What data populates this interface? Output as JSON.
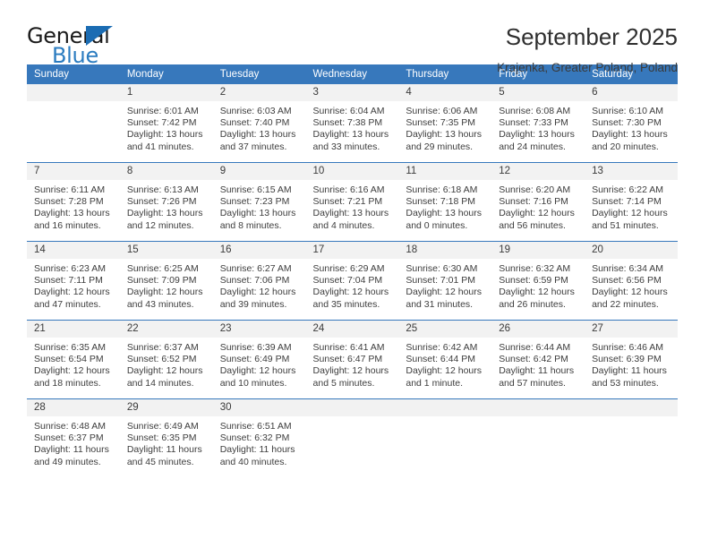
{
  "logo": {
    "word_top": "General",
    "word_bottom": "Blue",
    "triangle_color": "#1b6cb3",
    "blue_text_color": "#2b7cc0"
  },
  "header": {
    "title": "September 2025",
    "location": "Krajenka, Greater Poland, Poland"
  },
  "theme": {
    "header_blue": "#3778bc",
    "daynum_band": "#f2f2f2",
    "text": "#3d3d3d"
  },
  "weekday_headers": [
    "Sunday",
    "Monday",
    "Tuesday",
    "Wednesday",
    "Thursday",
    "Friday",
    "Saturday"
  ],
  "weeks": [
    [
      {
        "day": "",
        "sunrise": "",
        "sunset": "",
        "daylight1": "",
        "daylight2": ""
      },
      {
        "day": "1",
        "sunrise": "Sunrise: 6:01 AM",
        "sunset": "Sunset: 7:42 PM",
        "daylight1": "Daylight: 13 hours",
        "daylight2": "and 41 minutes."
      },
      {
        "day": "2",
        "sunrise": "Sunrise: 6:03 AM",
        "sunset": "Sunset: 7:40 PM",
        "daylight1": "Daylight: 13 hours",
        "daylight2": "and 37 minutes."
      },
      {
        "day": "3",
        "sunrise": "Sunrise: 6:04 AM",
        "sunset": "Sunset: 7:38 PM",
        "daylight1": "Daylight: 13 hours",
        "daylight2": "and 33 minutes."
      },
      {
        "day": "4",
        "sunrise": "Sunrise: 6:06 AM",
        "sunset": "Sunset: 7:35 PM",
        "daylight1": "Daylight: 13 hours",
        "daylight2": "and 29 minutes."
      },
      {
        "day": "5",
        "sunrise": "Sunrise: 6:08 AM",
        "sunset": "Sunset: 7:33 PM",
        "daylight1": "Daylight: 13 hours",
        "daylight2": "and 24 minutes."
      },
      {
        "day": "6",
        "sunrise": "Sunrise: 6:10 AM",
        "sunset": "Sunset: 7:30 PM",
        "daylight1": "Daylight: 13 hours",
        "daylight2": "and 20 minutes."
      }
    ],
    [
      {
        "day": "7",
        "sunrise": "Sunrise: 6:11 AM",
        "sunset": "Sunset: 7:28 PM",
        "daylight1": "Daylight: 13 hours",
        "daylight2": "and 16 minutes."
      },
      {
        "day": "8",
        "sunrise": "Sunrise: 6:13 AM",
        "sunset": "Sunset: 7:26 PM",
        "daylight1": "Daylight: 13 hours",
        "daylight2": "and 12 minutes."
      },
      {
        "day": "9",
        "sunrise": "Sunrise: 6:15 AM",
        "sunset": "Sunset: 7:23 PM",
        "daylight1": "Daylight: 13 hours",
        "daylight2": "and 8 minutes."
      },
      {
        "day": "10",
        "sunrise": "Sunrise: 6:16 AM",
        "sunset": "Sunset: 7:21 PM",
        "daylight1": "Daylight: 13 hours",
        "daylight2": "and 4 minutes."
      },
      {
        "day": "11",
        "sunrise": "Sunrise: 6:18 AM",
        "sunset": "Sunset: 7:18 PM",
        "daylight1": "Daylight: 13 hours",
        "daylight2": "and 0 minutes."
      },
      {
        "day": "12",
        "sunrise": "Sunrise: 6:20 AM",
        "sunset": "Sunset: 7:16 PM",
        "daylight1": "Daylight: 12 hours",
        "daylight2": "and 56 minutes."
      },
      {
        "day": "13",
        "sunrise": "Sunrise: 6:22 AM",
        "sunset": "Sunset: 7:14 PM",
        "daylight1": "Daylight: 12 hours",
        "daylight2": "and 51 minutes."
      }
    ],
    [
      {
        "day": "14",
        "sunrise": "Sunrise: 6:23 AM",
        "sunset": "Sunset: 7:11 PM",
        "daylight1": "Daylight: 12 hours",
        "daylight2": "and 47 minutes."
      },
      {
        "day": "15",
        "sunrise": "Sunrise: 6:25 AM",
        "sunset": "Sunset: 7:09 PM",
        "daylight1": "Daylight: 12 hours",
        "daylight2": "and 43 minutes."
      },
      {
        "day": "16",
        "sunrise": "Sunrise: 6:27 AM",
        "sunset": "Sunset: 7:06 PM",
        "daylight1": "Daylight: 12 hours",
        "daylight2": "and 39 minutes."
      },
      {
        "day": "17",
        "sunrise": "Sunrise: 6:29 AM",
        "sunset": "Sunset: 7:04 PM",
        "daylight1": "Daylight: 12 hours",
        "daylight2": "and 35 minutes."
      },
      {
        "day": "18",
        "sunrise": "Sunrise: 6:30 AM",
        "sunset": "Sunset: 7:01 PM",
        "daylight1": "Daylight: 12 hours",
        "daylight2": "and 31 minutes."
      },
      {
        "day": "19",
        "sunrise": "Sunrise: 6:32 AM",
        "sunset": "Sunset: 6:59 PM",
        "daylight1": "Daylight: 12 hours",
        "daylight2": "and 26 minutes."
      },
      {
        "day": "20",
        "sunrise": "Sunrise: 6:34 AM",
        "sunset": "Sunset: 6:56 PM",
        "daylight1": "Daylight: 12 hours",
        "daylight2": "and 22 minutes."
      }
    ],
    [
      {
        "day": "21",
        "sunrise": "Sunrise: 6:35 AM",
        "sunset": "Sunset: 6:54 PM",
        "daylight1": "Daylight: 12 hours",
        "daylight2": "and 18 minutes."
      },
      {
        "day": "22",
        "sunrise": "Sunrise: 6:37 AM",
        "sunset": "Sunset: 6:52 PM",
        "daylight1": "Daylight: 12 hours",
        "daylight2": "and 14 minutes."
      },
      {
        "day": "23",
        "sunrise": "Sunrise: 6:39 AM",
        "sunset": "Sunset: 6:49 PM",
        "daylight1": "Daylight: 12 hours",
        "daylight2": "and 10 minutes."
      },
      {
        "day": "24",
        "sunrise": "Sunrise: 6:41 AM",
        "sunset": "Sunset: 6:47 PM",
        "daylight1": "Daylight: 12 hours",
        "daylight2": "and 5 minutes."
      },
      {
        "day": "25",
        "sunrise": "Sunrise: 6:42 AM",
        "sunset": "Sunset: 6:44 PM",
        "daylight1": "Daylight: 12 hours",
        "daylight2": "and 1 minute."
      },
      {
        "day": "26",
        "sunrise": "Sunrise: 6:44 AM",
        "sunset": "Sunset: 6:42 PM",
        "daylight1": "Daylight: 11 hours",
        "daylight2": "and 57 minutes."
      },
      {
        "day": "27",
        "sunrise": "Sunrise: 6:46 AM",
        "sunset": "Sunset: 6:39 PM",
        "daylight1": "Daylight: 11 hours",
        "daylight2": "and 53 minutes."
      }
    ],
    [
      {
        "day": "28",
        "sunrise": "Sunrise: 6:48 AM",
        "sunset": "Sunset: 6:37 PM",
        "daylight1": "Daylight: 11 hours",
        "daylight2": "and 49 minutes."
      },
      {
        "day": "29",
        "sunrise": "Sunrise: 6:49 AM",
        "sunset": "Sunset: 6:35 PM",
        "daylight1": "Daylight: 11 hours",
        "daylight2": "and 45 minutes."
      },
      {
        "day": "30",
        "sunrise": "Sunrise: 6:51 AM",
        "sunset": "Sunset: 6:32 PM",
        "daylight1": "Daylight: 11 hours",
        "daylight2": "and 40 minutes."
      },
      {
        "day": "",
        "sunrise": "",
        "sunset": "",
        "daylight1": "",
        "daylight2": ""
      },
      {
        "day": "",
        "sunrise": "",
        "sunset": "",
        "daylight1": "",
        "daylight2": ""
      },
      {
        "day": "",
        "sunrise": "",
        "sunset": "",
        "daylight1": "",
        "daylight2": ""
      },
      {
        "day": "",
        "sunrise": "",
        "sunset": "",
        "daylight1": "",
        "daylight2": ""
      }
    ]
  ]
}
